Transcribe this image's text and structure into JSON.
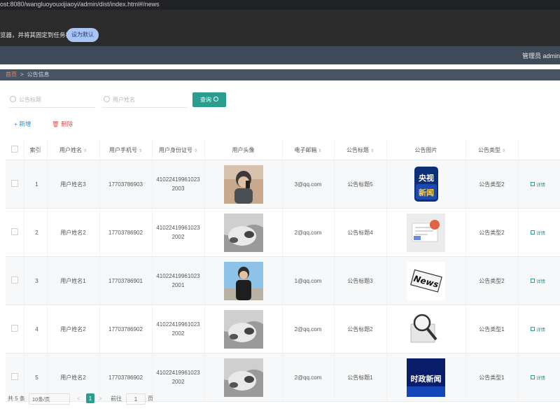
{
  "browser": {
    "address": "ost:8080/wangluoyouxijiaoyi/admin/dist/index.html#/news"
  },
  "notice": {
    "message": "览器，并将其固定到任务栏",
    "button": "设为默认"
  },
  "topbar": {
    "user": "管理员 admin"
  },
  "breadcrumb": {
    "home": "首页",
    "separator": ">",
    "current": "公告信息"
  },
  "search": {
    "title_placeholder": "公告标题",
    "user_placeholder": "用户姓名",
    "query_button": "查询"
  },
  "actions": {
    "add": "+ 新增",
    "delete": "删除"
  },
  "table": {
    "columns": [
      "索引",
      "用户姓名",
      "用户手机号",
      "用户身份证号",
      "用户头像",
      "电子邮箱",
      "公告标题",
      "公告图片",
      "公告类型"
    ],
    "detail_label": "详情",
    "rows": [
      {
        "index": "1",
        "name": "用户姓名3",
        "phone": "17703786903",
        "id_line1": "41022419961023",
        "id_line2": "2003",
        "email": "3@qq.com",
        "title": "公告标题5",
        "type": "公告类型2"
      },
      {
        "index": "2",
        "name": "用户姓名2",
        "phone": "17703786902",
        "id_line1": "41022419961023",
        "id_line2": "2002",
        "email": "2@qq.com",
        "title": "公告标题4",
        "type": "公告类型2"
      },
      {
        "index": "3",
        "name": "用户姓名1",
        "phone": "17703786901",
        "id_line1": "41022419961023",
        "id_line2": "2001",
        "email": "1@qq.com",
        "title": "公告标题3",
        "type": "公告类型2"
      },
      {
        "index": "4",
        "name": "用户姓名2",
        "phone": "17703786902",
        "id_line1": "41022419961023",
        "id_line2": "2002",
        "email": "2@qq.com",
        "title": "公告标题2",
        "type": "公告类型1"
      },
      {
        "index": "5",
        "name": "用户姓名2",
        "phone": "17703786902",
        "id_line1": "41022419961023",
        "id_line2": "2002",
        "email": "2@qq.com",
        "title": "公告标题1",
        "type": "公告类型1"
      }
    ]
  },
  "images": {
    "cctv_line1": "央视",
    "cctv_line2": "新闻",
    "news_word": "News",
    "politics": "时政新闻"
  },
  "pager": {
    "total": "共 5 条",
    "page_size": "10条/页",
    "prev": "<",
    "current_page": "1",
    "next": ">",
    "goto_label": "前往",
    "goto_value": "1",
    "page_unit": "页"
  },
  "colors": {
    "accent": "#2a9d8f",
    "topbar": "#3e4a57",
    "breadcrumb": "#475564",
    "delete": "#e05454",
    "add": "#2a8fd1"
  }
}
